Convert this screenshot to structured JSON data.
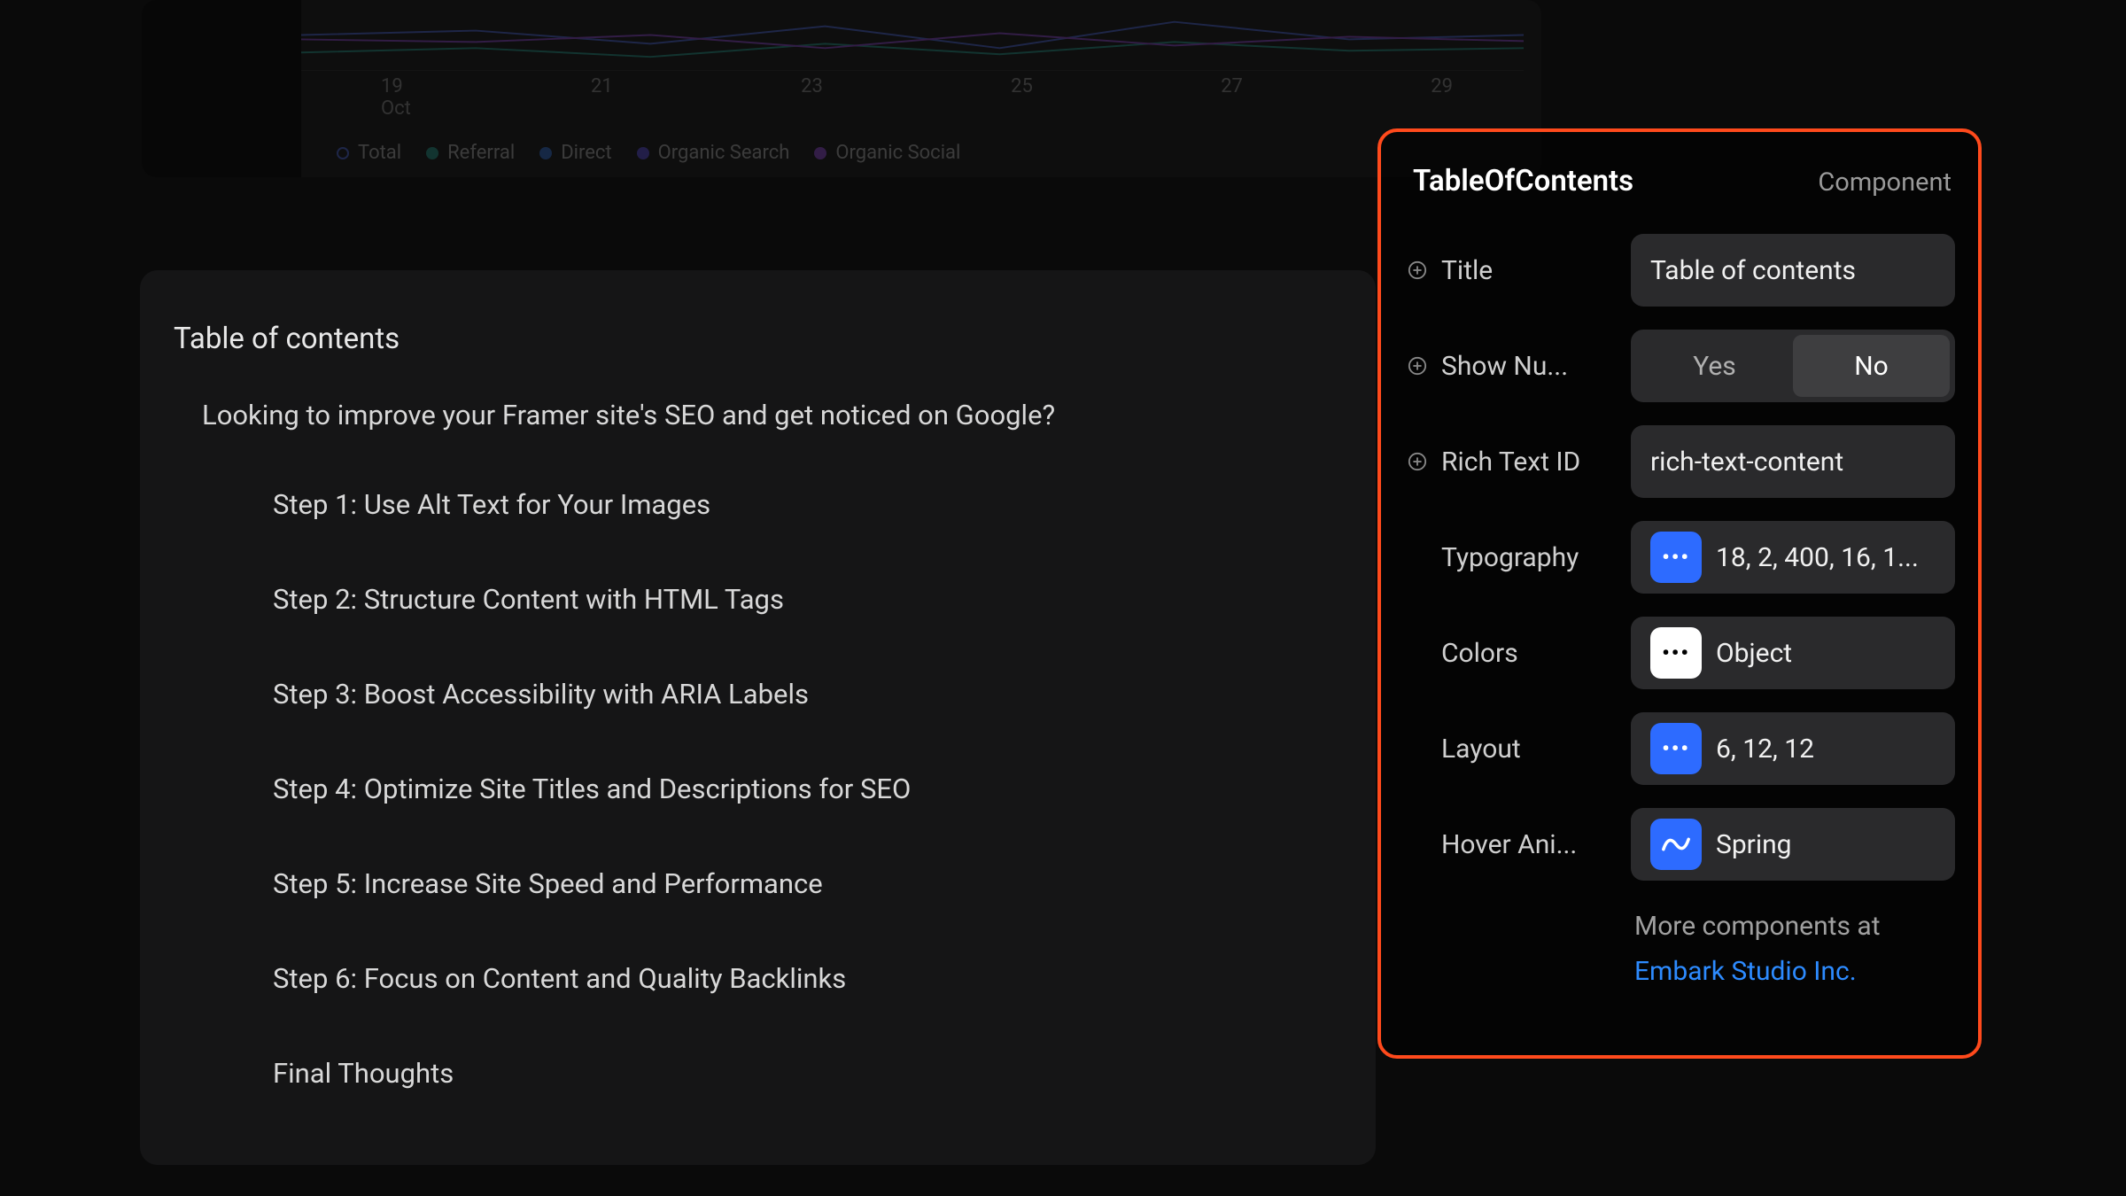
{
  "chart": {
    "dates": [
      "19",
      "21",
      "23",
      "25",
      "27",
      "29"
    ],
    "month": "Oct",
    "legend": [
      {
        "label": "Total",
        "color": "#5b7cff",
        "ring": true
      },
      {
        "label": "Referral",
        "color": "#2bb3a0"
      },
      {
        "label": "Direct",
        "color": "#3b82f6"
      },
      {
        "label": "Organic Search",
        "color": "#6a5cff"
      },
      {
        "label": "Organic Social",
        "color": "#a855f7"
      }
    ]
  },
  "toc": {
    "title": "Table of contents",
    "intro": "Looking to improve your Framer site's SEO and get noticed on Google?",
    "items": [
      "Step 1: Use Alt Text for Your Images",
      "Step 2: Structure Content with HTML Tags",
      "Step 3: Boost Accessibility with ARIA Labels",
      "Step 4: Optimize Site Titles and Descriptions for SEO",
      "Step 5: Increase Site Speed and Performance",
      "Step 6: Focus on Content and Quality Backlinks",
      "Final Thoughts"
    ]
  },
  "panel": {
    "title": "TableOfContents",
    "type": "Component",
    "props": {
      "title": {
        "label": "Title",
        "value": "Table of contents"
      },
      "showNumbers": {
        "label": "Show Nu...",
        "options": [
          "Yes",
          "No"
        ],
        "selected": "No"
      },
      "richTextId": {
        "label": "Rich Text ID",
        "value": "rich-text-content"
      },
      "typography": {
        "label": "Typography",
        "value": "18, 2, 400, 16, 1..."
      },
      "colors": {
        "label": "Colors",
        "value": "Object"
      },
      "layout": {
        "label": "Layout",
        "value": "6, 12, 12"
      },
      "hoverAnimation": {
        "label": "Hover Ani...",
        "value": "Spring"
      }
    },
    "footer": {
      "text": "More components at",
      "link": "Embark Studio Inc."
    }
  }
}
